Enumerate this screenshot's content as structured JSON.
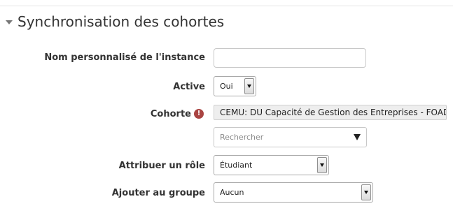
{
  "section": {
    "title": "Synchronisation des cohortes",
    "caret_icon": "caret-down-icon"
  },
  "fields": {
    "instance_name": {
      "label": "Nom personnalisé de l'instance",
      "value": "",
      "placeholder": ""
    },
    "active": {
      "label": "Active",
      "value": "Oui"
    },
    "cohort": {
      "label": "Cohorte",
      "required_icon": "exclamation-circle-icon",
      "required_glyph": "!",
      "selected": "CEMU: DU Capacité de Gestion des Entreprises - FOAD",
      "search_placeholder": "Rechercher"
    },
    "role": {
      "label": "Attribuer un rôle",
      "value": "Étudiant"
    },
    "group": {
      "label": "Ajouter au groupe",
      "value": "Aucun"
    }
  },
  "colors": {
    "required": "#a94442",
    "text": "#333333"
  }
}
